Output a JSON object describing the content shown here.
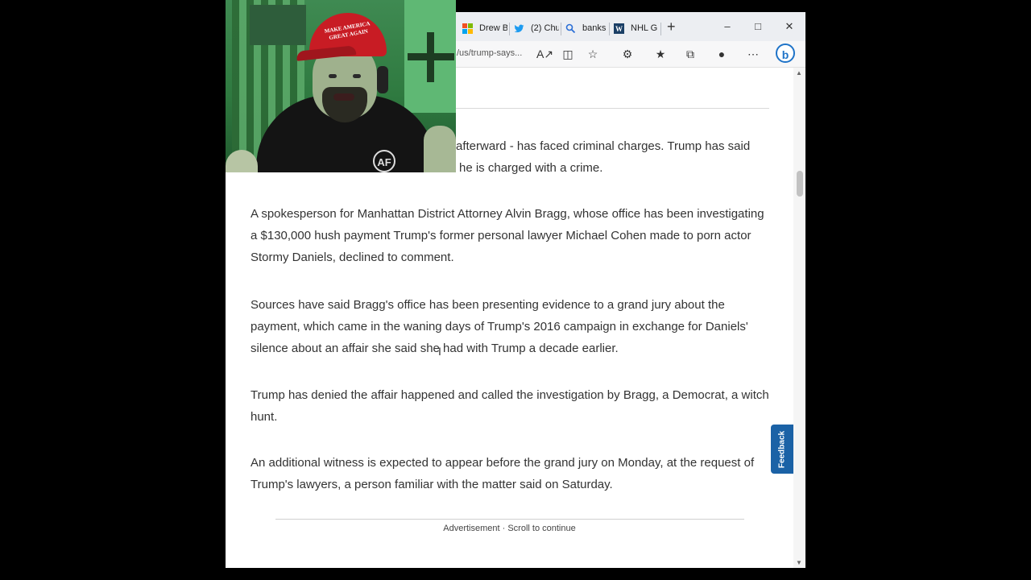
{
  "browser": {
    "tabs": [
      {
        "label": "Drew B",
        "icon": "microsoft-icon"
      },
      {
        "label": "(2) Chu",
        "icon": "twitter-icon"
      },
      {
        "label": "banks",
        "icon": "search-icon"
      },
      {
        "label": "NHL G",
        "icon": "wp-icon"
      }
    ],
    "url": "/us/trump-says...",
    "bing_label": "b"
  },
  "article": {
    "paragraphs": [
      "afterward - has faced criminal charges. Trump has said",
      "he is charged with a crime.",
      "A spokesperson for Manhattan District Attorney Alvin Bragg, whose office has been investigating a $130,000 hush payment Trump's former personal lawyer Michael Cohen made to porn actor Stormy Daniels, declined to comment.",
      "Sources have said Bragg's office has been presenting evidence to a grand jury about the payment, which came in the waning days of Trump's 2016 campaign in exchange for Daniels' silence about an affair she said she had with Trump a decade earlier.",
      "Trump has denied the affair happened and called the investigation by Bragg, a Democrat, a witch hunt.",
      "An additional witness is expected to appear before the grand jury on Monday, at the request of Trump's lawyers, a person familiar with the matter said on Saturday."
    ],
    "ad_text": "Advertisement · Scroll to continue",
    "feedback_label": "Feedback"
  },
  "webcam": {
    "cap_text": "MAKE AMERICA GREAT AGAIN",
    "logo_text": "AF"
  },
  "colors": {
    "feedback_bg": "#1b62a6",
    "cap_red": "#c81c24",
    "text": "#333333"
  }
}
